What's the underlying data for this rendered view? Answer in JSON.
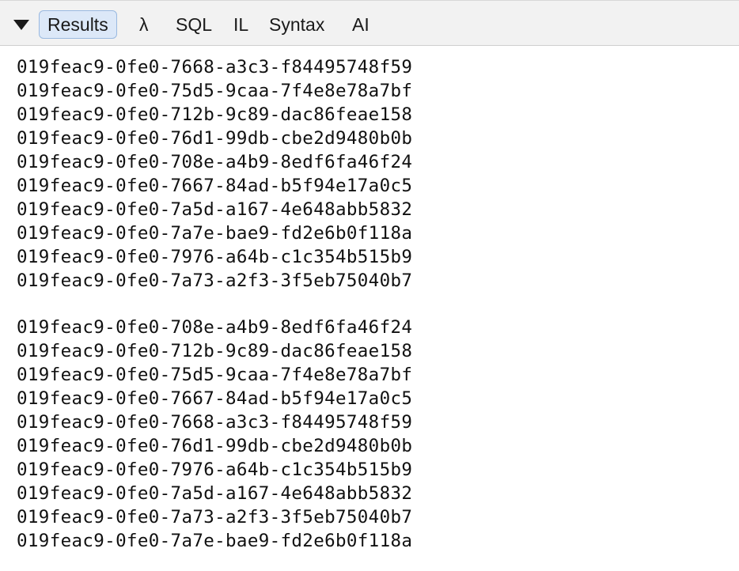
{
  "toolbar": {
    "tabs": [
      {
        "label": "Results",
        "active": true
      },
      {
        "label": "λ",
        "active": false
      },
      {
        "label": "SQL",
        "active": false
      },
      {
        "label": "IL",
        "active": false
      },
      {
        "label": "Syntax",
        "active": false
      },
      {
        "label": "AI",
        "active": false
      }
    ],
    "toggle_icon": "triangle-down-icon"
  },
  "results": {
    "block1": [
      "019feac9-0fe0-7668-a3c3-f84495748f59",
      "019feac9-0fe0-75d5-9caa-7f4e8e78a7bf",
      "019feac9-0fe0-712b-9c89-dac86feae158",
      "019feac9-0fe0-76d1-99db-cbe2d9480b0b",
      "019feac9-0fe0-708e-a4b9-8edf6fa46f24",
      "019feac9-0fe0-7667-84ad-b5f94e17a0c5",
      "019feac9-0fe0-7a5d-a167-4e648abb5832",
      "019feac9-0fe0-7a7e-bae9-fd2e6b0f118a",
      "019feac9-0fe0-7976-a64b-c1c354b515b9",
      "019feac9-0fe0-7a73-a2f3-3f5eb75040b7"
    ],
    "block2": [
      "019feac9-0fe0-708e-a4b9-8edf6fa46f24",
      "019feac9-0fe0-712b-9c89-dac86feae158",
      "019feac9-0fe0-75d5-9caa-7f4e8e78a7bf",
      "019feac9-0fe0-7667-84ad-b5f94e17a0c5",
      "019feac9-0fe0-7668-a3c3-f84495748f59",
      "019feac9-0fe0-76d1-99db-cbe2d9480b0b",
      "019feac9-0fe0-7976-a64b-c1c354b515b9",
      "019feac9-0fe0-7a5d-a167-4e648abb5832",
      "019feac9-0fe0-7a73-a2f3-3f5eb75040b7",
      "019feac9-0fe0-7a7e-bae9-fd2e6b0f118a"
    ]
  }
}
